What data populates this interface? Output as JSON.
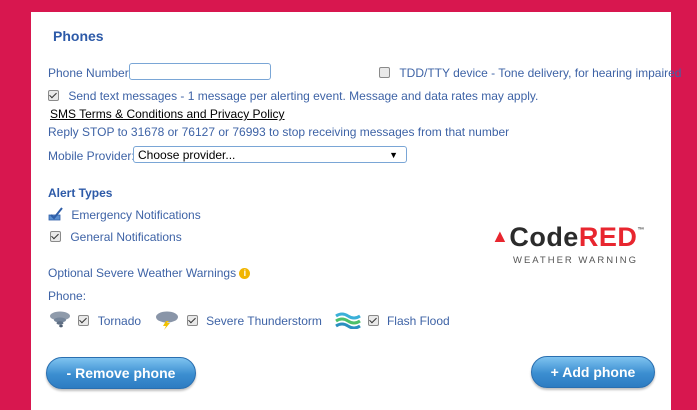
{
  "section_title": "Phones",
  "phone_number_label": "Phone Number:",
  "phone_number_value": "",
  "tdd_label": "TDD/TTY device - Tone delivery, for hearing impaired",
  "send_text_label": "Send text messages - 1 message per alerting event. Message and data rates may apply.",
  "sms_terms_link": "SMS Terms & Conditions and Privacy Policy",
  "reply_stop_text": "Reply STOP to 31678 or 76127 or 76993 to stop receiving messages from that number",
  "mobile_provider_label": "Mobile Provider:",
  "mobile_provider_value": "Choose provider...",
  "alert_types_heading": "Alert Types",
  "alert_types": {
    "emergency": "Emergency Notifications",
    "general": "General Notifications"
  },
  "optional_weather_label": "Optional Severe Weather Warnings",
  "phone_label": "Phone:",
  "weather": {
    "tornado": "Tornado",
    "thunderstorm": "Severe Thunderstorm",
    "flood": "Flash Flood"
  },
  "logo": {
    "brand_code": "Code",
    "brand_red": "RED",
    "subtitle": "WEATHER WARNING"
  },
  "buttons": {
    "remove": "- Remove phone",
    "add": "+ Add phone"
  },
  "colors": {
    "background": "#d8174f",
    "accent_blue": "#2d5aa8",
    "brand_red": "#e8262f"
  }
}
